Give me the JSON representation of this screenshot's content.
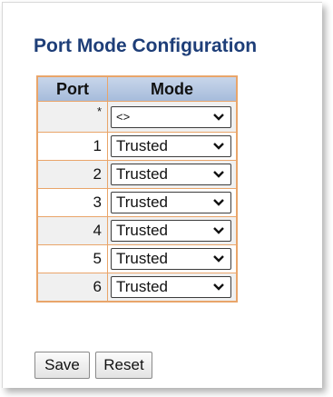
{
  "page": {
    "title": "Port Mode Configuration"
  },
  "table": {
    "headers": {
      "port": "Port",
      "mode": "Mode"
    },
    "rows": [
      {
        "port": "*",
        "mode": "<>"
      },
      {
        "port": "1",
        "mode": "Trusted"
      },
      {
        "port": "2",
        "mode": "Trusted"
      },
      {
        "port": "3",
        "mode": "Trusted"
      },
      {
        "port": "4",
        "mode": "Trusted"
      },
      {
        "port": "5",
        "mode": "Trusted"
      },
      {
        "port": "6",
        "mode": "Trusted"
      }
    ]
  },
  "buttons": {
    "save": "Save",
    "reset": "Reset"
  },
  "icons": {
    "dropdown": "chevron-down-icon"
  },
  "colors": {
    "title": "#1e3e78",
    "table_border": "#e9a56a",
    "header_bg": "#b4c6e0",
    "odd_row_bg": "#f0f0f0"
  }
}
